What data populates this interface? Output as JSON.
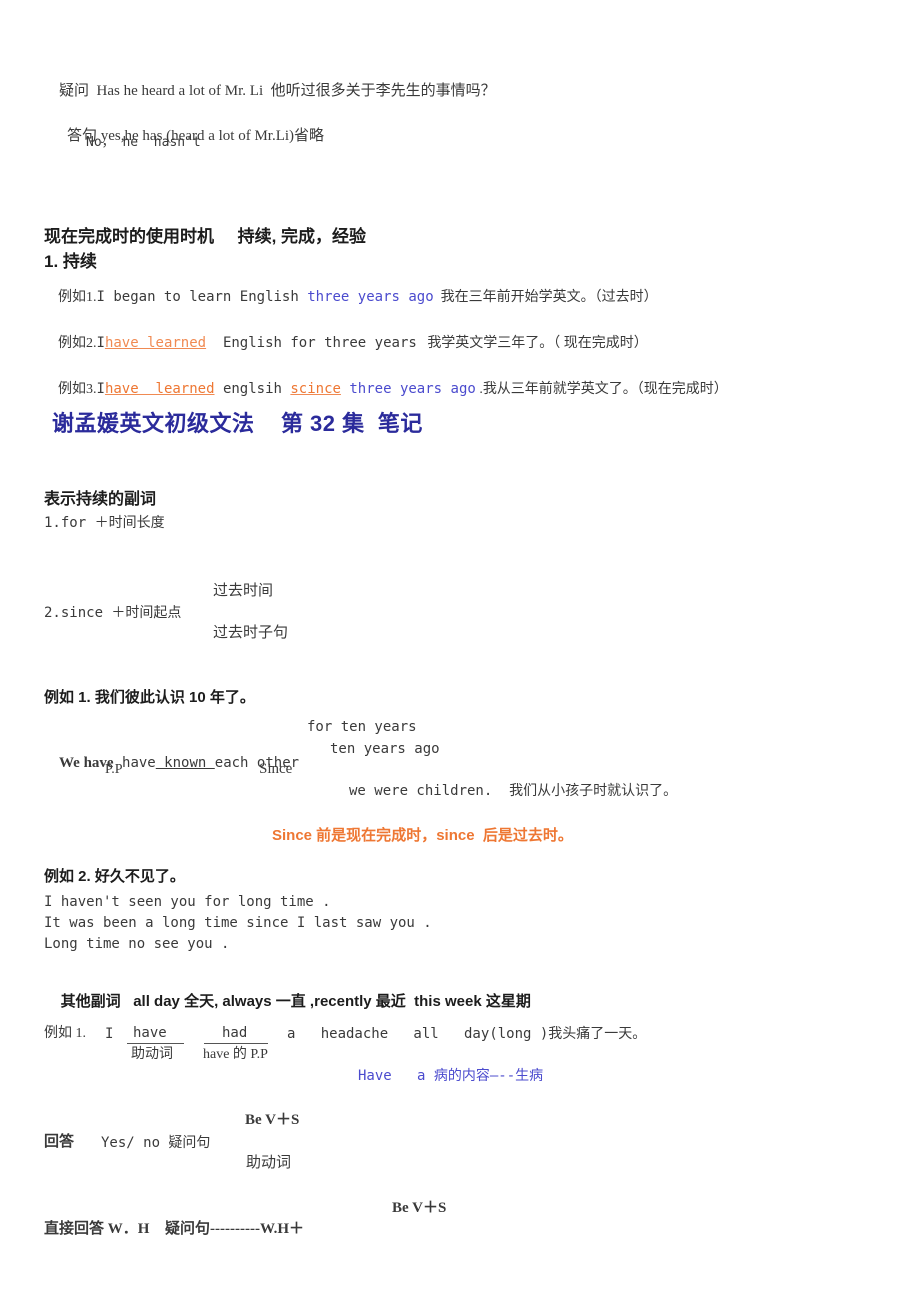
{
  "document": {
    "title": "谢孟媛英文初级文法    第 32 集  笔记",
    "language": "zh-CN / en"
  },
  "section_qa": {
    "question_label": "疑问",
    "question_en": "Has he heard a lot of Mr. Li",
    "question_zh": "他听过很多关于李先生的事情吗？",
    "answer_label": "答句",
    "answer_yes": "yes,he has (heard a lot of Mr.Li)省略",
    "answer_no": "No， he  hasn't"
  },
  "section_usage": {
    "heading": "现在完成时的使用时机     持续, 完成，经验",
    "sub_heading": "1. 持续",
    "examples": [
      {
        "prefix": "例如1.",
        "part1": "I began to learn English ",
        "highlight": "three years ago",
        "highlight_color": "#4B4BCE",
        "suffix": "  我在三年前开始学英文。（过去时）"
      },
      {
        "prefix": "例如2.",
        "lead": "I",
        "underlined": "have learned",
        "underlined_color": "#F08A52",
        "part2": "  English for three years",
        "suffix": "   我学英文学三年了。（ 现在完成时）"
      },
      {
        "prefix": "例如3.",
        "lead": "I",
        "underlined": "have  learned",
        "underlined_color": "#EE7733",
        "mid": " englsih ",
        "underlined2": "scince",
        "highlight": " three years ago",
        "highlight_color": "#4B4BCE",
        "suffix": " .我从三年前就学英文了。（现在完成时）"
      }
    ]
  },
  "section_adverbs": {
    "heading": "表示持续的副词",
    "item1": "1.for ＋时间长度",
    "item2": "2.since ＋时间起点",
    "item2_branch_top": "过去时间",
    "item2_branch_bottom": "过去时子句"
  },
  "section_example1": {
    "title": "例如 1. 我们彼此认识 10 年了。",
    "for_ten_years": "for ten years",
    "main_a": "We have",
    "main_underlined": " known ",
    "main_b": "each other",
    "ten_years_ago": "ten years ago",
    "pp_label": "P.P",
    "since_label": "Since",
    "we_were_children": "we were children.  我们从小孩子时就认识了。",
    "note": "Since 前是现在完成时，since  后是过去时。",
    "note_color": "#EE7733"
  },
  "section_example2": {
    "title": "例如 2. 好久不见了。",
    "lines": [
      "I haven't seen you for long time .",
      "It was been a long time since I last saw you .",
      "Long time no see you ."
    ]
  },
  "section_other_adverbs": {
    "label": "其他副词",
    "text": "all day 全天, always 一直 ,recently 最近  this week 这星期"
  },
  "section_example3": {
    "prefix": "例如 1.",
    "subject": "I",
    "aux_word": "have",
    "pp_word": "had",
    "rest": "a   headache   all   day(long )我头痛了一天。",
    "aux_label": "助动词",
    "pp_label": "have 的 P.P",
    "blue_note": "Have   a 病的内容—--生病",
    "blue_note_color": "#4B4BCE"
  },
  "section_answers": {
    "be_vs_top": "Be V＋S",
    "answer_label": "回答",
    "answer_text": "Yes/ no 疑问句",
    "aux_label": "助动词",
    "be_vs_bottom": "Be V＋S",
    "direct_label": "直接回答 W．H",
    "direct_text": "疑问句----------W.H＋"
  }
}
